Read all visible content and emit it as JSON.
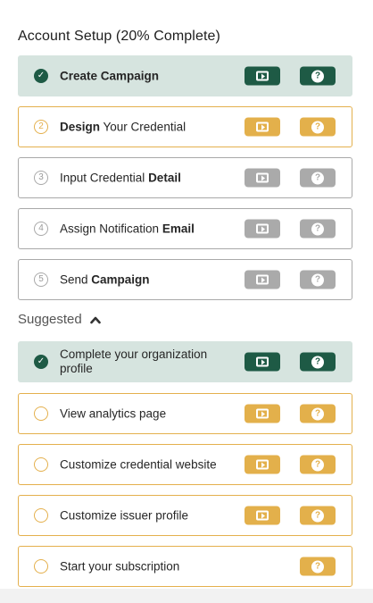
{
  "header": {
    "title": "Account Setup (20% Complete)"
  },
  "colors": {
    "done_bg": "#d6e4df",
    "done_accent": "#1e5a45",
    "active_accent": "#e3b04b",
    "locked_accent": "#aaaaaa"
  },
  "steps": [
    {
      "marker": "✓",
      "label": "Create Campaign",
      "state": "done",
      "play_icon": "play-icon",
      "help_icon": "help-icon",
      "help_glyph": "?"
    },
    {
      "marker": "2",
      "pre": "",
      "bold": "Design",
      "post": " Your Credential",
      "state": "active",
      "help_glyph": "?"
    },
    {
      "marker": "3",
      "pre": "Input Credential ",
      "bold": "Detail",
      "post": "",
      "state": "locked",
      "help_glyph": "?"
    },
    {
      "marker": "4",
      "pre": "Assign Notification ",
      "bold": "Email",
      "post": "",
      "state": "locked",
      "help_glyph": "?"
    },
    {
      "marker": "5",
      "pre": "Send ",
      "bold": "Campaign",
      "post": "",
      "state": "locked",
      "help_glyph": "?"
    }
  ],
  "suggested": {
    "label": "Suggested",
    "toggle_icon": "chevron-up-icon",
    "items": [
      {
        "marker": "✓",
        "label": "Complete your organization profile",
        "state": "done",
        "help_glyph": "?"
      },
      {
        "label": "View analytics page",
        "state": "todo",
        "help_glyph": "?"
      },
      {
        "label": "Customize credential website",
        "state": "todo",
        "help_glyph": "?"
      },
      {
        "label": "Customize issuer profile",
        "state": "todo",
        "help_glyph": "?"
      },
      {
        "label": "Start your subscription",
        "state": "todo",
        "help_glyph": "?"
      }
    ]
  }
}
